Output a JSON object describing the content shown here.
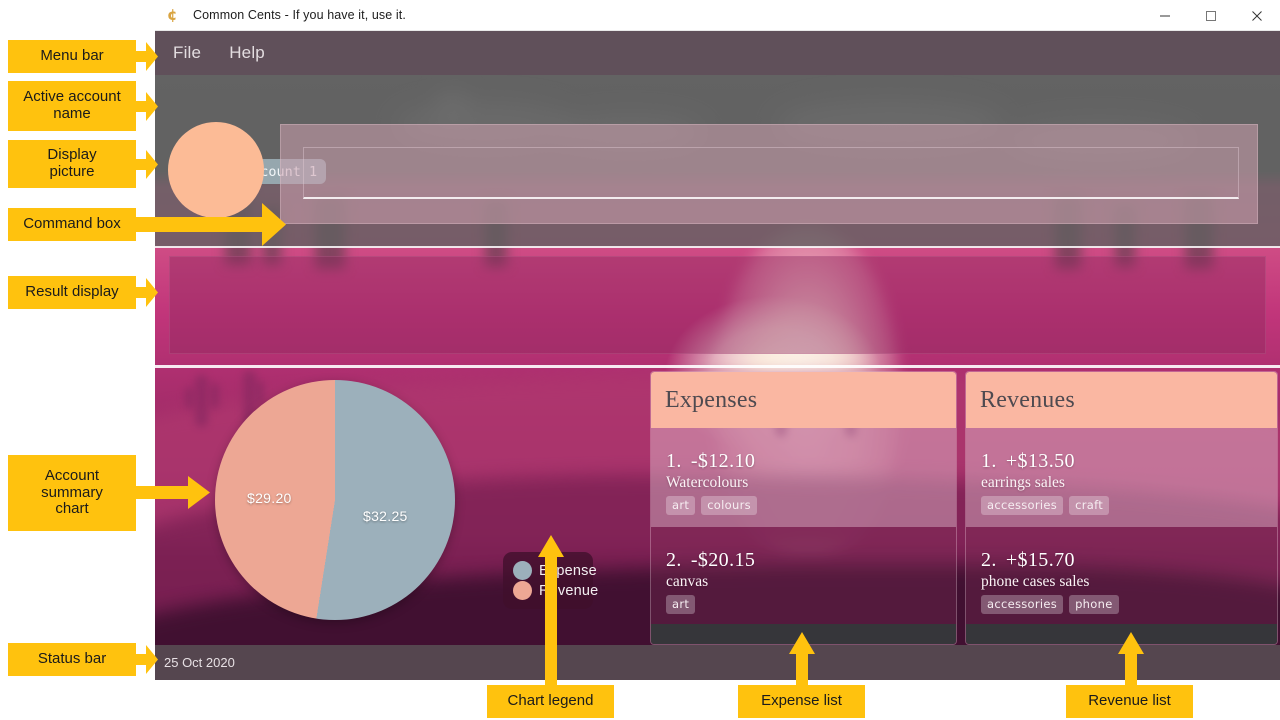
{
  "window": {
    "title": "Common Cents - If you have it, use it.",
    "icon": "cent-currency-icon",
    "controls": {
      "minimize": "minimize-icon",
      "maximize": "maximize-icon",
      "close": "close-icon"
    }
  },
  "menubar": {
    "items": [
      {
        "label": "File"
      },
      {
        "label": "Help"
      }
    ]
  },
  "account": {
    "badge_label": "Default account 1"
  },
  "command": {
    "value": "",
    "placeholder": ""
  },
  "result": {
    "text": ""
  },
  "chart_data": {
    "type": "pie",
    "title": "Account summary chart",
    "categories": [
      "Expense",
      "Revenue"
    ],
    "values": [
      32.25,
      29.2
    ],
    "labels": [
      "$32.25",
      "$29.20"
    ],
    "colors": [
      "#9cb0bb",
      "#eda794"
    ],
    "legend_position": "right",
    "legend": [
      {
        "label": "Expense",
        "color": "#9cb0bb"
      },
      {
        "label": "Revenue",
        "color": "#eda794"
      }
    ]
  },
  "expenses": {
    "title": "Expenses",
    "items": [
      {
        "index": "1.",
        "amount": "-$12.10",
        "description": "Watercolours",
        "tags": [
          "art",
          "colours"
        ]
      },
      {
        "index": "2.",
        "amount": "-$20.15",
        "description": "canvas",
        "tags": [
          "art"
        ]
      }
    ]
  },
  "revenues": {
    "title": "Revenues",
    "items": [
      {
        "index": "1.",
        "amount": "+$13.50",
        "description": "earrings sales",
        "tags": [
          "accessories",
          "craft"
        ]
      },
      {
        "index": "2.",
        "amount": "+$15.70",
        "description": "phone cases sales",
        "tags": [
          "accessories",
          "phone"
        ]
      }
    ]
  },
  "statusbar": {
    "text": "25 Oct 2020"
  },
  "annotations": {
    "accent_color": "#ffc20e",
    "menu_bar": "Menu bar",
    "active_account_name": "Active account\nname",
    "display_picture": "Display\npicture",
    "command_box": "Command box",
    "result_display": "Result display",
    "account_summary_chart": "Account\nsummary\nchart",
    "status_bar": "Status bar",
    "chart_legend": "Chart legend",
    "expense_list": "Expense list",
    "revenue_list": "Revenue list"
  }
}
